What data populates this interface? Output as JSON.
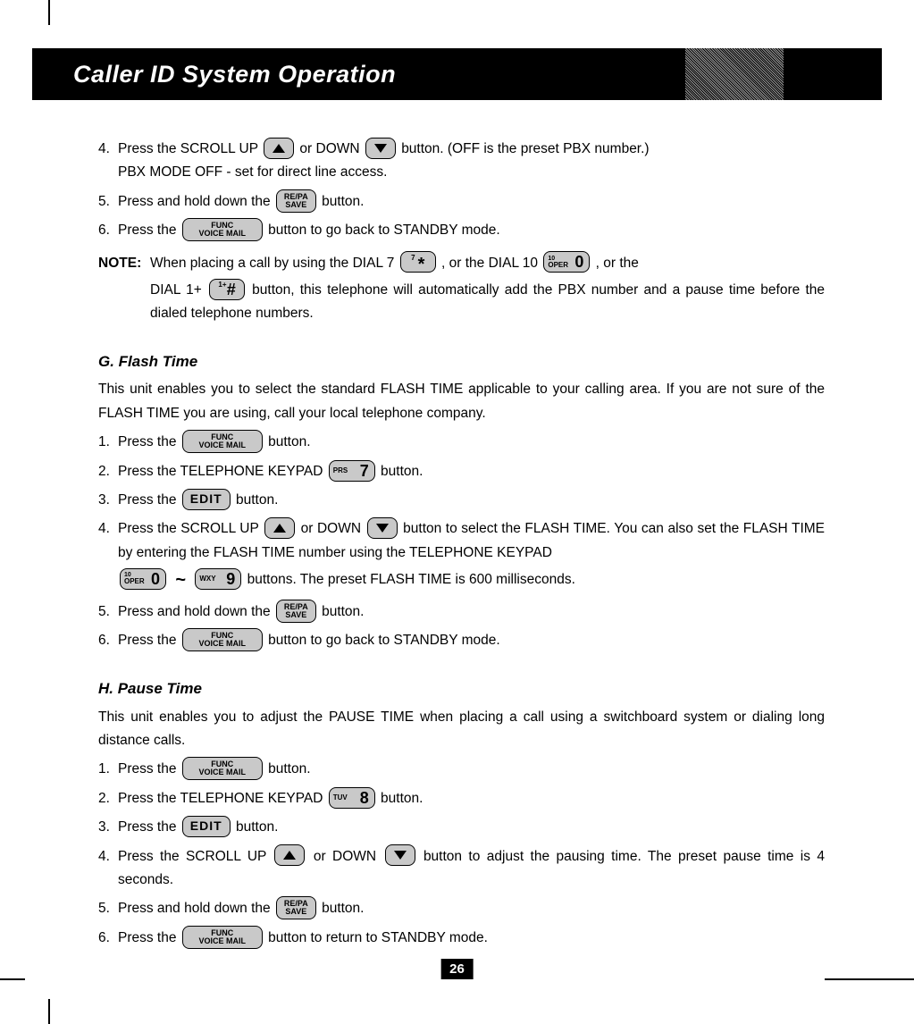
{
  "header": {
    "title": "Caller ID System Operation"
  },
  "page_number": "26",
  "buttons": {
    "resave_top": "RE/PA",
    "resave_bottom": "SAVE",
    "func_top": "FUNC",
    "func_bottom": "VOICE  MAIL",
    "edit": "EDIT"
  },
  "keys": {
    "star_sup": "7",
    "star_sym": "*",
    "zero_sup": "10",
    "zero_label": "OPER",
    "zero_digit": "0",
    "hash_sup": "1+",
    "hash_sym": "#",
    "seven_label": "PRS",
    "seven_digit": "7",
    "eight_label": "TUV",
    "eight_digit": "8",
    "nine_label": "WXY",
    "nine_digit": "9"
  },
  "top_steps": {
    "s4_a": "Press the SCROLL UP ",
    "s4_b": " or DOWN ",
    "s4_c": " button. (OFF is the preset PBX number.)",
    "s4_line2": "PBX MODE OFF - set for direct line access.",
    "s5_a": "Press and hold down the ",
    "s5_b": " button.",
    "s6_a": "Press the ",
    "s6_b": " button to go back to STANDBY mode."
  },
  "note": {
    "label": "NOTE",
    "line1_a": "When placing a call by using the DIAL 7 ",
    "line1_b": ", or the DIAL 10 ",
    "line1_c": ", or the",
    "line2_a": "DIAL 1+ ",
    "line2_b": " button, this telephone will automatically add the PBX number and a pause time before the dialed telephone numbers."
  },
  "section_g": {
    "title": "G. Flash Time",
    "intro": "This unit enables you to select the standard FLASH TIME applicable to your calling area. If you are not sure of the FLASH TIME you are using, call your local telephone company.",
    "s1_a": "Press the ",
    "s1_b": " button.",
    "s2_a": "Press the TELEPHONE KEYPAD ",
    "s2_b": " button.",
    "s3_a": "Press the ",
    "s3_b": " button.",
    "s4_a": "Press the SCROLL UP ",
    "s4_b": " or DOWN ",
    "s4_c": " button to select the FLASH TIME. You can also set the FLASH TIME by entering the FLASH TIME number using the TELEPHONE KEYPAD",
    "s4_d": " buttons. The preset FLASH TIME is 600 milliseconds.",
    "s5_a": "Press and hold down the ",
    "s5_b": " button.",
    "s6_a": "Press the ",
    "s6_b": " button to go back to STANDBY mode."
  },
  "section_h": {
    "title": "H. Pause Time",
    "intro": "This unit enables you to adjust the PAUSE TIME when placing a call using a switchboard system or dialing long distance calls.",
    "s1_a": "Press the ",
    "s1_b": " button.",
    "s2_a": "Press the TELEPHONE KEYPAD ",
    "s2_b": " button.",
    "s3_a": "Press the ",
    "s3_b": " button.",
    "s4_a": "Press the SCROLL UP ",
    "s4_b": " or DOWN ",
    "s4_c": " button to adjust the pausing time. The preset pause time is 4 seconds.",
    "s5_a": "Press and hold down the ",
    "s5_b": " button.",
    "s6_a": "Press the ",
    "s6_b": " button to return to STANDBY mode."
  },
  "nums": {
    "n1": "1.",
    "n2": "2.",
    "n3": "3.",
    "n4": "4.",
    "n5": "5.",
    "n6": "6."
  },
  "tilde": "~"
}
